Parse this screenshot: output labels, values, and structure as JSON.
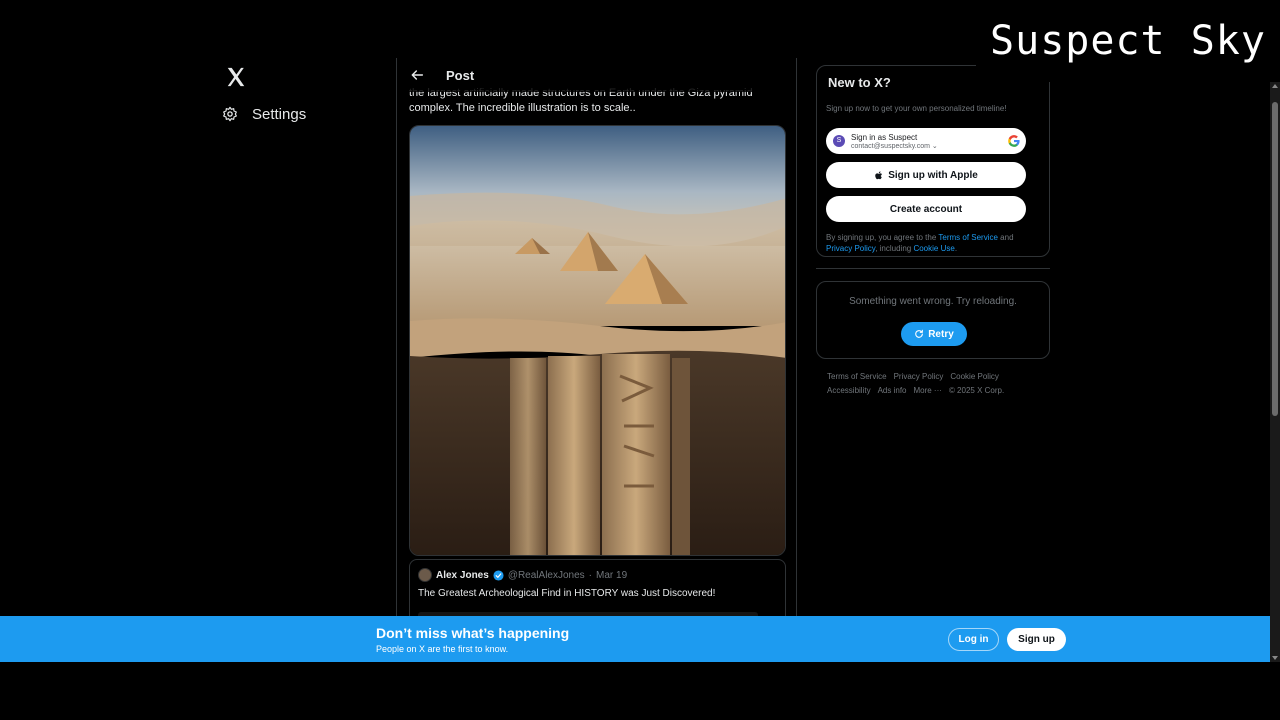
{
  "watermark": "Suspect Sky",
  "nav": {
    "settings_label": "Settings",
    "logo": "x-logo-icon",
    "settings_icon": "gear-icon"
  },
  "post": {
    "header_title": "Post",
    "text_line1": "the largest artificially made structures on Earth under the Giza pyramid",
    "text_line2": "complex. The incredible illustration is to scale..",
    "quote": {
      "name": "Alex Jones",
      "handle": "@RealAlexJones",
      "separator": "·",
      "date": "Mar 19",
      "text": "The Greatest Archeological Find in HISTORY was Just Discovered!"
    }
  },
  "signup": {
    "title": "New to X?",
    "subtitle": "Sign up now to get your own personalized timeline!",
    "google_line1": "Sign in as Suspect",
    "google_line2": "contact@suspectsky.com",
    "google_avatar_letter": "S",
    "apple_label": "Sign up with Apple",
    "create_label": "Create account",
    "terms_prefix": "By signing up, you agree to the ",
    "terms_link": "Terms of Service",
    "terms_and": " and ",
    "privacy_link": "Privacy Policy",
    "terms_including": ", including ",
    "cookie_link": "Cookie Use",
    "terms_end": "."
  },
  "error_card": {
    "message": "Something went wrong. Try reloading.",
    "retry_label": "Retry"
  },
  "footer": {
    "links": [
      "Terms of Service",
      "Privacy Policy",
      "Cookie Policy",
      "Accessibility",
      "Ads info",
      "More ···",
      "© 2025 X Corp."
    ]
  },
  "banner": {
    "title": "Don’t miss what’s happening",
    "subtitle": "People on X are the first to know.",
    "login_label": "Log in",
    "signup_label": "Sign up"
  },
  "colors": {
    "accent": "#1d9bf0",
    "background": "#000000",
    "border": "#2f3336"
  }
}
